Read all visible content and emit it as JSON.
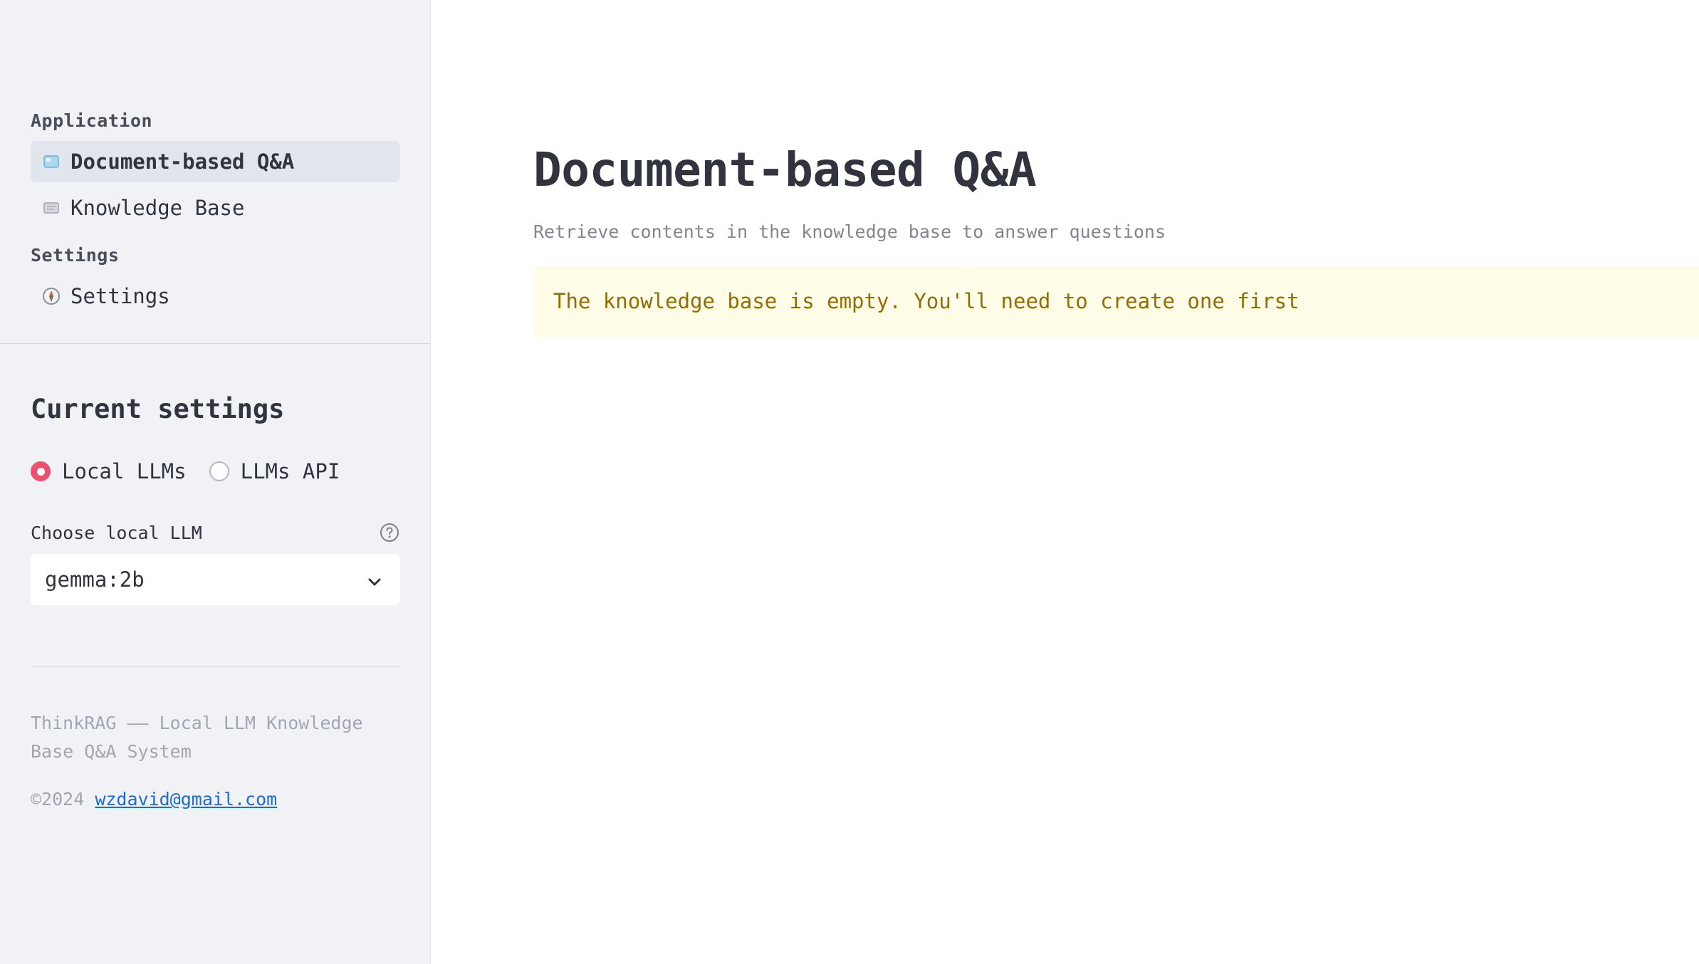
{
  "sidebar": {
    "sections": {
      "application": "Application",
      "settings": "Settings"
    },
    "nav": [
      {
        "label": "Document-based Q&A",
        "icon": "ice-cube-icon",
        "active": true
      },
      {
        "label": "Knowledge Base",
        "icon": "scroll-icon",
        "active": false
      },
      {
        "label": "Settings",
        "icon": "compass-icon",
        "active": false
      }
    ],
    "current_settings": {
      "title": "Current settings",
      "radio": [
        {
          "label": "Local LLMs",
          "selected": true
        },
        {
          "label": "LLMs API",
          "selected": false
        }
      ],
      "select_label": "Choose local LLM",
      "select_value": "gemma:2b"
    },
    "footer": {
      "description": "ThinkRAG —— Local LLM Knowledge Base Q&A System",
      "copyright_prefix": "©2024",
      "email": "wzdavid@gmail.com"
    }
  },
  "main": {
    "title": "Document-based Q&A",
    "caption": "Retrieve contents in the knowledge base to answer questions",
    "alert": "The knowledge base is empty. You'll need to create one first"
  },
  "colors": {
    "sidebar_bg": "#f0f2f6",
    "accent": "#ef4f6e",
    "alert_bg": "#fffce7",
    "alert_text": "#926c05",
    "link": "#1c6bd6"
  }
}
